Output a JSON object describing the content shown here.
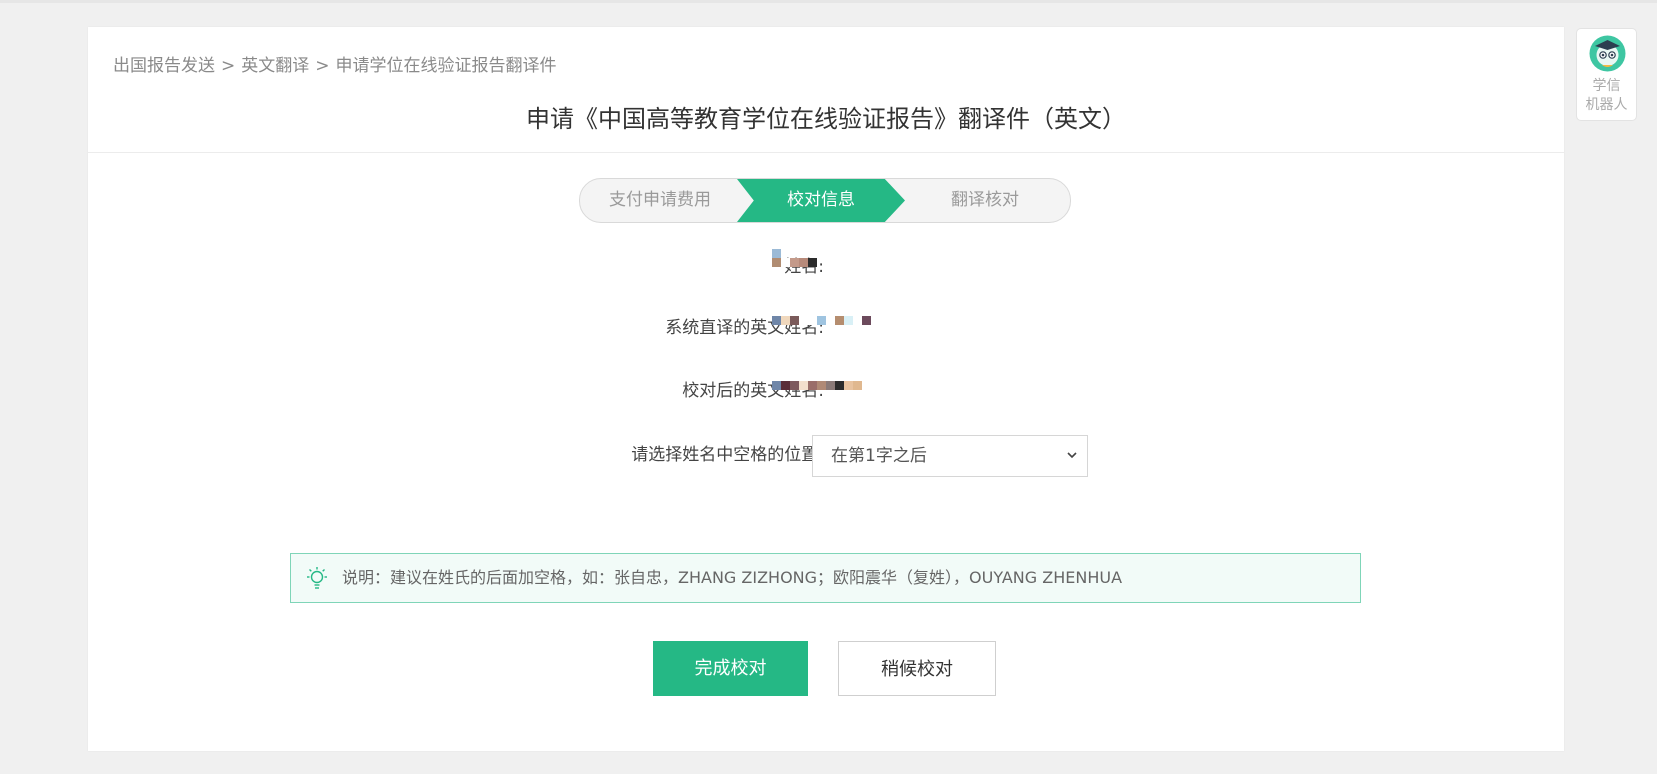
{
  "breadcrumb": {
    "items": [
      "出国报告发送",
      "英文翻译",
      "申请学位在线验证报告翻译件"
    ],
    "separator": ">"
  },
  "page_title": "申请《中国高等教育学位在线验证报告》翻译件（英文）",
  "steps": [
    {
      "label": "支付申请费用",
      "state": "done"
    },
    {
      "label": "校对信息",
      "state": "active"
    },
    {
      "label": "翻译核对",
      "state": "pending"
    }
  ],
  "form": {
    "name_label": "姓名:",
    "system_name_label": "系统直译的英文姓名:",
    "proofread_name_label": "校对后的英文姓名:",
    "space_position_label": "请选择姓名中空格的位置:",
    "space_position_value": "在第1字之后"
  },
  "note": {
    "text": "说明：建议在姓氏的后面加空格，如：张自忠，ZHANG ZIZHONG；欧阳震华（复姓），OUYANG ZHENHUA"
  },
  "buttons": {
    "complete": "完成校对",
    "later": "稍候校对"
  },
  "robot": {
    "label_line1": "学信",
    "label_line2": "机器人"
  },
  "colors": {
    "accent": "#25b885",
    "note_border": "#7fd5b8",
    "note_bg": "#f2fbf8"
  },
  "icons": [
    "bulb-icon",
    "chevron-down-icon",
    "robot-avatar-icon"
  ]
}
